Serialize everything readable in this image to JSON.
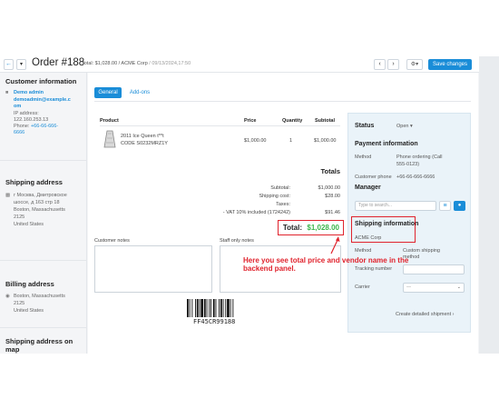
{
  "header": {
    "order_title": "Order #188",
    "summary_prefix": "Total: $1,028.00 / ACME Corp",
    "summary_date": "/ 09/13/2024,17:50",
    "back_icon": "arrow-left-icon",
    "dropdown_icon": "caret-down-icon",
    "prev_icon": "chevron-left-icon",
    "next_icon": "chevron-right-icon",
    "gear_icon": "gear-icon",
    "save_label": "Save changes"
  },
  "sidebar": {
    "customer_title": "Customer information",
    "customer_name": "Demo admin",
    "customer_email_1": "demoadmin@example.c",
    "customer_email_2": "om",
    "ip_label": "IP address:",
    "ip_value": "122.160.253.13",
    "phone_label": "Phone:",
    "phone_value_1": "+66-66-666-",
    "phone_value_2": "6666",
    "shipping_title": "Shipping address",
    "shipping_lines": [
      "г Москва, Дмитровское",
      "шоссе, д 163 стр 18",
      "Boston, Massachusetts",
      "2125",
      "United States"
    ],
    "billing_title": "Billing address",
    "billing_lines": [
      "Boston, Massachusetts",
      "2125",
      "United States"
    ],
    "map_title_1": "Shipping address on",
    "map_title_2": "map"
  },
  "tabs": {
    "general": "General",
    "addons": "Add-ons"
  },
  "products": {
    "headers": {
      "product": "Product",
      "price": "Price",
      "quantity": "Quantity",
      "subtotal": "Subtotal"
    },
    "rows": [
      {
        "name": "2011 Ice Queen t**t",
        "code": "CODE S0232MRZ1Y",
        "price": "$1,000.00",
        "quantity": "1",
        "subtotal": "$1,000.00"
      }
    ]
  },
  "totals": {
    "title": "Totals",
    "subtotal_label": "Subtotal:",
    "subtotal_value": "$1,000.00",
    "shipping_label": "Shipping cost:",
    "shipping_value": "$28.00",
    "taxes_label": "Taxes:",
    "vat_label": "- VAT 10% included (1724242)",
    "vat_value": "$91.46",
    "total_label": "Total:",
    "total_value": "$1,028.00"
  },
  "notes": {
    "customer": "Customer notes",
    "staff": "Staff only notes"
  },
  "barcode_text": "FF45CR99188",
  "status_panel": {
    "status_label": "Status",
    "status_value": "Open ▾",
    "payment_title": "Payment information",
    "method_label": "Method",
    "method_value_1": "Phone ordering (Call",
    "method_value_2": "555-0123)",
    "customer_phone_label": "Customer phone",
    "customer_phone_value": "+66-66-666-6666",
    "manager_title": "Manager",
    "manager_placeholder": "Type to search...",
    "shipping_info_title": "Shipping information",
    "vendor_name": "ACME Corp",
    "ship_method_label": "Method",
    "ship_method_value_1": "Custom shipping",
    "ship_method_value_2": "method",
    "tracking_label": "Tracking number",
    "carrier_label": "Carrier",
    "carrier_value": "—",
    "create_shipment": "Create detailed shipment ›"
  },
  "annotation": {
    "line1": "Here you see total price and vendor name in the",
    "line2": "backend panel."
  },
  "colors": {
    "accent": "#1a8dd8",
    "highlight": "#e0232d",
    "total_green": "#3bb54a"
  }
}
